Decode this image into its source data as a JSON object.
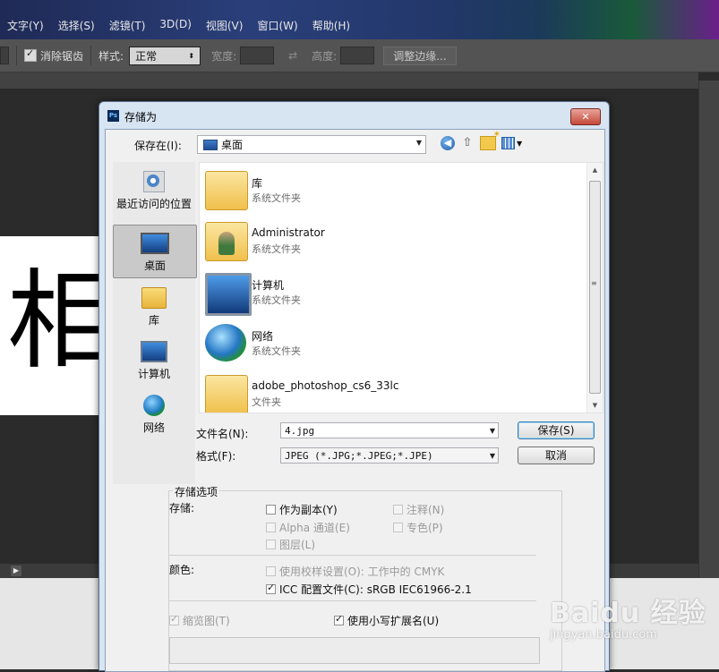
{
  "ps": {
    "menu": [
      "文字(Y)",
      "选择(S)",
      "滤镜(T)",
      "3D(D)",
      "视图(V)",
      "窗口(W)",
      "帮助(H)"
    ],
    "options": {
      "antialias": "消除锯齿",
      "style_label": "样式:",
      "style_value": "正常",
      "width_label": "宽度:",
      "height_label": "高度:",
      "adjust_edge": "调整边缘..."
    },
    "canvas_char": "相"
  },
  "dialog": {
    "title": "存储为",
    "close": "✕",
    "save_in_label": "保存在(I):",
    "save_in_value": "桌面",
    "places": [
      "最近访问的位置",
      "桌面",
      "库",
      "计算机",
      "网络"
    ],
    "files": [
      {
        "name": "库",
        "type": "系统文件夹"
      },
      {
        "name": "Administrator",
        "type": "系统文件夹"
      },
      {
        "name": "计算机",
        "type": "系统文件夹"
      },
      {
        "name": "网络",
        "type": "系统文件夹"
      },
      {
        "name": "adobe_photoshop_cs6_33lc",
        "type": "文件夹"
      }
    ],
    "filename_label": "文件名(N):",
    "filename_value": "4.jpg",
    "format_label": "格式(F):",
    "format_value": "JPEG (*.JPG;*.JPEG;*.JPE)",
    "save_button": "保存(S)",
    "cancel_button": "取消",
    "options": {
      "legend": "存储选项",
      "store_label": "存储:",
      "as_copy": "作为副本(Y)",
      "annotations": "注释(N)",
      "alpha": "Alpha 通道(E)",
      "spot": "专色(P)",
      "layers": "图层(L)",
      "color_label": "颜色:",
      "proof": "使用校样设置(O): 工作中的 CMYK",
      "icc": "ICC 配置文件(C): sRGB IEC61966-2.1",
      "thumbnail": "缩览图(T)",
      "lowercase_ext": "使用小写扩展名(U)"
    }
  },
  "watermark": {
    "brand": "Baidu 经验",
    "url": "jingyan.baidu.com"
  }
}
